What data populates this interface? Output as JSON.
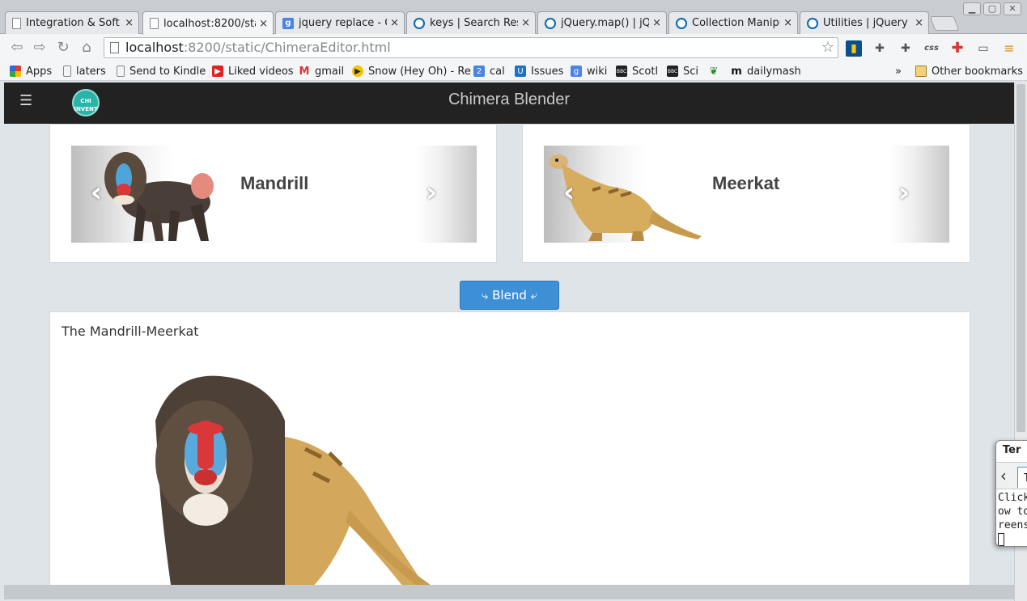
{
  "browser": {
    "tabs": [
      {
        "title": "Integration & Soft",
        "icon": "page-icon"
      },
      {
        "title": "localhost:8200/sta",
        "icon": "page-icon",
        "active": true
      },
      {
        "title": "jquery replace - G",
        "icon": "google-icon"
      },
      {
        "title": "keys | Search Resu",
        "icon": "jquery-icon"
      },
      {
        "title": "jQuery.map() | jQu",
        "icon": "jquery-icon"
      },
      {
        "title": "Collection Manipul",
        "icon": "jquery-icon"
      },
      {
        "title": "Utilities | jQuery A",
        "icon": "jquery-icon"
      }
    ],
    "tab_close": "×",
    "url_host": "localhost",
    "url_path": ":8200/static/ChimeraEditor.html",
    "bookmarks": [
      "Apps",
      "laters",
      "Send to Kindle",
      "Liked videos",
      "gmail",
      "Snow (Hey Oh) - Re",
      "cal",
      "Issues",
      "wiki",
      "Scotl",
      "Sci",
      "dailymash"
    ],
    "bookmarks_overflow": "»",
    "other_bookmarks": "Other bookmarks",
    "ext_css": "css"
  },
  "app": {
    "title": "Chimera Blender",
    "logo_text": "CHI INVENT",
    "left_animal": "Mandrill",
    "right_animal": "Meerkat",
    "blend_button": "⤷ Blend ⤶",
    "result_title": "The Mandrill-Meerkat"
  },
  "terminal": {
    "title": "Ter",
    "tab_label": "T",
    "lines": [
      "Click",
      "ow to",
      "reens"
    ]
  },
  "colors": {
    "appbar": "#222222",
    "blend_button": "#3d8fd6",
    "page_bg": "#dfe4e9"
  }
}
